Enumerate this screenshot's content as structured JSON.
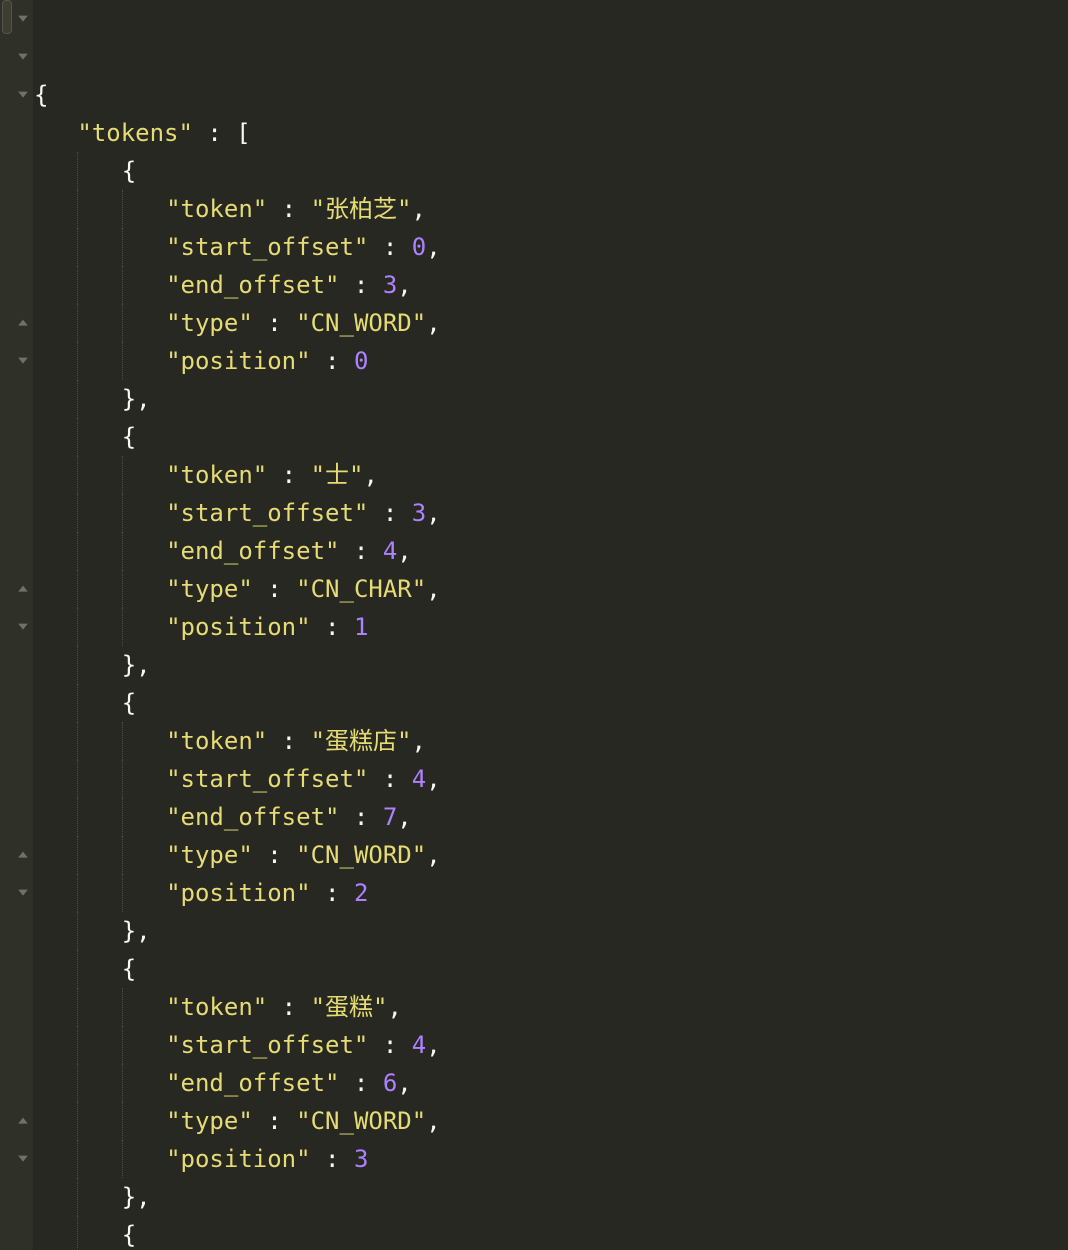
{
  "lines": [
    {
      "indent": 0,
      "fold": "down",
      "parts": [
        {
          "t": "punct",
          "v": "{"
        }
      ]
    },
    {
      "indent": 1,
      "fold": "down",
      "parts": [
        {
          "t": "key",
          "v": "\"tokens\""
        },
        {
          "t": "punct",
          "v": " : ["
        }
      ]
    },
    {
      "indent": 2,
      "fold": "down",
      "parts": [
        {
          "t": "punct",
          "v": "{"
        }
      ]
    },
    {
      "indent": 3,
      "fold": "",
      "parts": [
        {
          "t": "key",
          "v": "\"token\""
        },
        {
          "t": "punct",
          "v": " : "
        },
        {
          "t": "str",
          "v": "\"张柏芝\""
        },
        {
          "t": "punct",
          "v": ","
        }
      ]
    },
    {
      "indent": 3,
      "fold": "",
      "parts": [
        {
          "t": "key",
          "v": "\"start_offset\""
        },
        {
          "t": "punct",
          "v": " : "
        },
        {
          "t": "num",
          "v": "0"
        },
        {
          "t": "punct",
          "v": ","
        }
      ]
    },
    {
      "indent": 3,
      "fold": "",
      "parts": [
        {
          "t": "key",
          "v": "\"end_offset\""
        },
        {
          "t": "punct",
          "v": " : "
        },
        {
          "t": "num",
          "v": "3"
        },
        {
          "t": "punct",
          "v": ","
        }
      ]
    },
    {
      "indent": 3,
      "fold": "",
      "parts": [
        {
          "t": "key",
          "v": "\"type\""
        },
        {
          "t": "punct",
          "v": " : "
        },
        {
          "t": "str",
          "v": "\"CN_WORD\""
        },
        {
          "t": "punct",
          "v": ","
        }
      ]
    },
    {
      "indent": 3,
      "fold": "",
      "parts": [
        {
          "t": "key",
          "v": "\"position\""
        },
        {
          "t": "punct",
          "v": " : "
        },
        {
          "t": "num",
          "v": "0"
        }
      ]
    },
    {
      "indent": 2,
      "fold": "up",
      "parts": [
        {
          "t": "punct",
          "v": "},"
        }
      ]
    },
    {
      "indent": 2,
      "fold": "down",
      "parts": [
        {
          "t": "punct",
          "v": "{"
        }
      ]
    },
    {
      "indent": 3,
      "fold": "",
      "parts": [
        {
          "t": "key",
          "v": "\"token\""
        },
        {
          "t": "punct",
          "v": " : "
        },
        {
          "t": "str",
          "v": "\"士\""
        },
        {
          "t": "punct",
          "v": ","
        }
      ]
    },
    {
      "indent": 3,
      "fold": "",
      "parts": [
        {
          "t": "key",
          "v": "\"start_offset\""
        },
        {
          "t": "punct",
          "v": " : "
        },
        {
          "t": "num",
          "v": "3"
        },
        {
          "t": "punct",
          "v": ","
        }
      ]
    },
    {
      "indent": 3,
      "fold": "",
      "parts": [
        {
          "t": "key",
          "v": "\"end_offset\""
        },
        {
          "t": "punct",
          "v": " : "
        },
        {
          "t": "num",
          "v": "4"
        },
        {
          "t": "punct",
          "v": ","
        }
      ]
    },
    {
      "indent": 3,
      "fold": "",
      "parts": [
        {
          "t": "key",
          "v": "\"type\""
        },
        {
          "t": "punct",
          "v": " : "
        },
        {
          "t": "str",
          "v": "\"CN_CHAR\""
        },
        {
          "t": "punct",
          "v": ","
        }
      ]
    },
    {
      "indent": 3,
      "fold": "",
      "parts": [
        {
          "t": "key",
          "v": "\"position\""
        },
        {
          "t": "punct",
          "v": " : "
        },
        {
          "t": "num",
          "v": "1"
        }
      ]
    },
    {
      "indent": 2,
      "fold": "up",
      "parts": [
        {
          "t": "punct",
          "v": "},"
        }
      ]
    },
    {
      "indent": 2,
      "fold": "down",
      "parts": [
        {
          "t": "punct",
          "v": "{"
        }
      ]
    },
    {
      "indent": 3,
      "fold": "",
      "parts": [
        {
          "t": "key",
          "v": "\"token\""
        },
        {
          "t": "punct",
          "v": " : "
        },
        {
          "t": "str",
          "v": "\"蛋糕店\""
        },
        {
          "t": "punct",
          "v": ","
        }
      ]
    },
    {
      "indent": 3,
      "fold": "",
      "parts": [
        {
          "t": "key",
          "v": "\"start_offset\""
        },
        {
          "t": "punct",
          "v": " : "
        },
        {
          "t": "num",
          "v": "4"
        },
        {
          "t": "punct",
          "v": ","
        }
      ]
    },
    {
      "indent": 3,
      "fold": "",
      "parts": [
        {
          "t": "key",
          "v": "\"end_offset\""
        },
        {
          "t": "punct",
          "v": " : "
        },
        {
          "t": "num",
          "v": "7"
        },
        {
          "t": "punct",
          "v": ","
        }
      ]
    },
    {
      "indent": 3,
      "fold": "",
      "parts": [
        {
          "t": "key",
          "v": "\"type\""
        },
        {
          "t": "punct",
          "v": " : "
        },
        {
          "t": "str",
          "v": "\"CN_WORD\""
        },
        {
          "t": "punct",
          "v": ","
        }
      ]
    },
    {
      "indent": 3,
      "fold": "",
      "parts": [
        {
          "t": "key",
          "v": "\"position\""
        },
        {
          "t": "punct",
          "v": " : "
        },
        {
          "t": "num",
          "v": "2"
        }
      ]
    },
    {
      "indent": 2,
      "fold": "up",
      "parts": [
        {
          "t": "punct",
          "v": "},"
        }
      ]
    },
    {
      "indent": 2,
      "fold": "down",
      "parts": [
        {
          "t": "punct",
          "v": "{"
        }
      ]
    },
    {
      "indent": 3,
      "fold": "",
      "parts": [
        {
          "t": "key",
          "v": "\"token\""
        },
        {
          "t": "punct",
          "v": " : "
        },
        {
          "t": "str",
          "v": "\"蛋糕\""
        },
        {
          "t": "punct",
          "v": ","
        }
      ]
    },
    {
      "indent": 3,
      "fold": "",
      "parts": [
        {
          "t": "key",
          "v": "\"start_offset\""
        },
        {
          "t": "punct",
          "v": " : "
        },
        {
          "t": "num",
          "v": "4"
        },
        {
          "t": "punct",
          "v": ","
        }
      ]
    },
    {
      "indent": 3,
      "fold": "",
      "parts": [
        {
          "t": "key",
          "v": "\"end_offset\""
        },
        {
          "t": "punct",
          "v": " : "
        },
        {
          "t": "num",
          "v": "6"
        },
        {
          "t": "punct",
          "v": ","
        }
      ]
    },
    {
      "indent": 3,
      "fold": "",
      "parts": [
        {
          "t": "key",
          "v": "\"type\""
        },
        {
          "t": "punct",
          "v": " : "
        },
        {
          "t": "str",
          "v": "\"CN_WORD\""
        },
        {
          "t": "punct",
          "v": ","
        }
      ]
    },
    {
      "indent": 3,
      "fold": "",
      "parts": [
        {
          "t": "key",
          "v": "\"position\""
        },
        {
          "t": "punct",
          "v": " : "
        },
        {
          "t": "num",
          "v": "3"
        }
      ]
    },
    {
      "indent": 2,
      "fold": "up",
      "parts": [
        {
          "t": "punct",
          "v": "},"
        }
      ]
    },
    {
      "indent": 2,
      "fold": "down",
      "parts": [
        {
          "t": "punct",
          "v": "{"
        }
      ]
    }
  ],
  "indent_unit": "   ",
  "guide_positions": [
    1,
    2,
    3
  ]
}
